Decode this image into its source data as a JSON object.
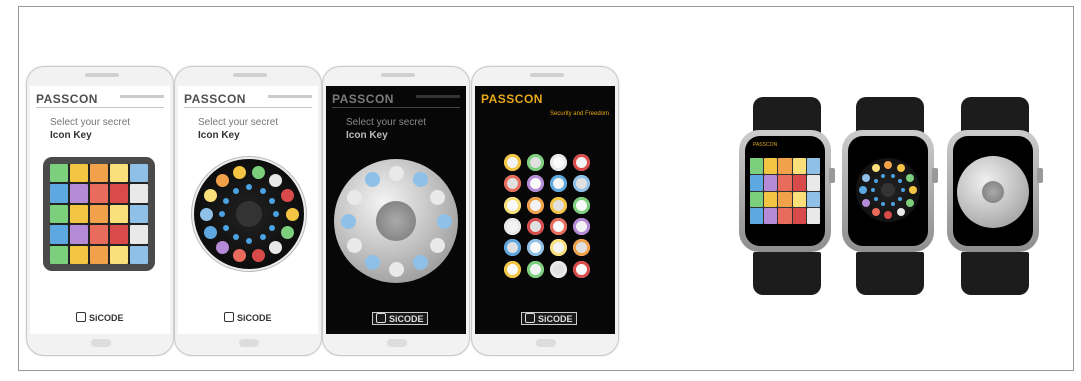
{
  "phones": [
    {
      "brand": "PASSCON",
      "line1": "Select your secret",
      "line2": "Icon Key",
      "logo": "SiCODE",
      "theme": "light"
    },
    {
      "brand": "PASSCON",
      "line1": "Select your secret",
      "line2": "Icon Key",
      "logo": "SiCODE",
      "theme": "light"
    },
    {
      "brand": "PASSCON",
      "line1": "Select your secret",
      "line2": "Icon Key",
      "logo": "SiCODE",
      "theme": "dark"
    },
    {
      "brand": "PASSCON",
      "line1": "",
      "line2": "",
      "tagline": "Security and Freedom",
      "logo": "SiCODE",
      "theme": "dark"
    }
  ],
  "watches": [
    {
      "name": "watch-grid-view",
      "label": "PASSCON"
    },
    {
      "name": "watch-dark-wheel-view",
      "label": ""
    },
    {
      "name": "watch-silver-wheel-view",
      "label": ""
    }
  ],
  "colors": {
    "accent": "#e6a719",
    "tiles": [
      "#f4c542",
      "#8fc0e8",
      "#e86b5b",
      "#7ccf7c",
      "#f9e07a",
      "#b58ad6",
      "#e9e9e9",
      "#f2a14b",
      "#5da8e0",
      "#d94b4b"
    ]
  }
}
